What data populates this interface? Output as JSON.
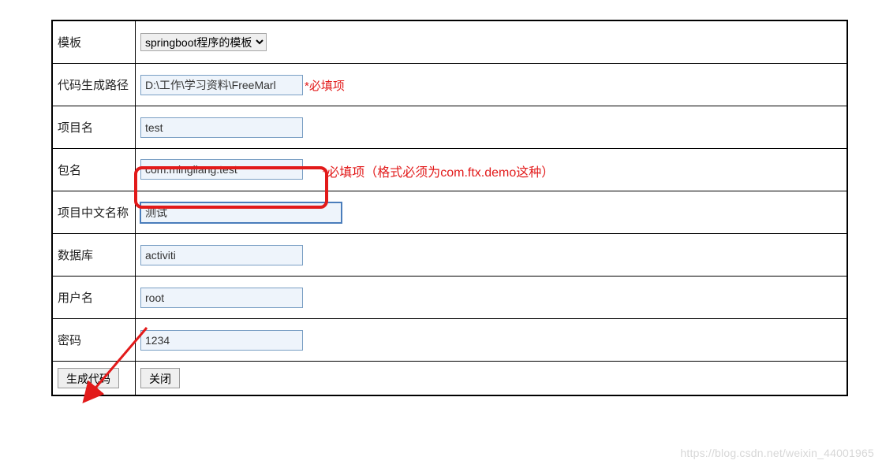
{
  "form": {
    "template": {
      "label": "模板",
      "selected": "springboot程序的模板"
    },
    "codegen_path": {
      "label": "代码生成路径",
      "value": "D:\\工作\\学习资料\\FreeMarl",
      "required_text": "*必填项"
    },
    "project_name": {
      "label": "项目名",
      "value": "test"
    },
    "package_name": {
      "label": "包名",
      "value": "com.mingliang.test",
      "required_text": "*必填项（格式必须为com.ftx.demo这种）"
    },
    "project_cn_name": {
      "label": "项目中文名称",
      "value": "测试"
    },
    "database": {
      "label": "数据库",
      "value": "activiti"
    },
    "username": {
      "label": "用户名",
      "value": "root"
    },
    "password": {
      "label": "密码",
      "value": "1234"
    }
  },
  "buttons": {
    "generate": "生成代码",
    "close": "关闭"
  },
  "watermark": "https://blog.csdn.net/weixin_44001965"
}
